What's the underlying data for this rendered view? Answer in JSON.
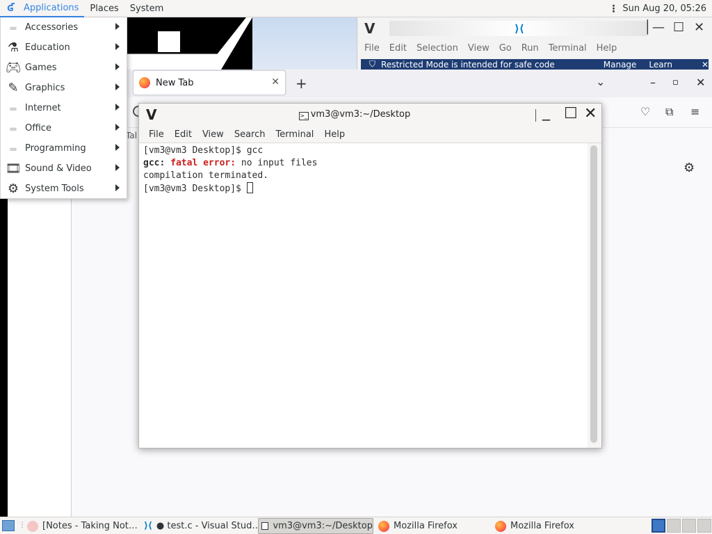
{
  "top_panel": {
    "menus": [
      "Applications",
      "Places",
      "System"
    ],
    "clock": "Sun Aug 20, 05:26"
  },
  "apps_menu": {
    "items": [
      {
        "label": "Accessories",
        "icon": "accessories-icon"
      },
      {
        "label": "Education",
        "icon": "education-flask-icon"
      },
      {
        "label": "Games",
        "icon": "games-gamepad-icon"
      },
      {
        "label": "Graphics",
        "icon": "graphics-palette-icon"
      },
      {
        "label": "Internet",
        "icon": "internet-icon"
      },
      {
        "label": "Office",
        "icon": "office-icon"
      },
      {
        "label": "Programming",
        "icon": "programming-icon"
      },
      {
        "label": "Sound & Video",
        "icon": "sound-video-film-icon"
      },
      {
        "label": "System Tools",
        "icon": "system-tools-gear-icon"
      }
    ]
  },
  "vscode": {
    "menus": [
      "File",
      "Edit",
      "Selection",
      "View",
      "Go",
      "Run",
      "Terminal",
      "Help"
    ],
    "banner_text": "Restricted Mode is intended for safe code browsing.",
    "banner_manage": "Manage",
    "banner_learn": "Learn More"
  },
  "firefox": {
    "tab_label": "New Tab",
    "partial_label": "Tal"
  },
  "terminal": {
    "title": "vm3@vm3:~/Desktop",
    "menus": [
      "File",
      "Edit",
      "View",
      "Search",
      "Terminal",
      "Help"
    ],
    "line1": "[vm3@vm3 Desktop]$ gcc",
    "line2_prog": "gcc:",
    "line2_err": "fatal error:",
    "line2_msg": "no input files",
    "line3": "compilation terminated.",
    "line4": "[vm3@vm3 Desktop]$"
  },
  "taskbar": {
    "tasks": [
      {
        "label": "[Notes - Taking Not…",
        "icon": "notes-app-icon"
      },
      {
        "label": "● test.c - Visual Stud…",
        "icon": "vscode-icon"
      },
      {
        "label": "vm3@vm3:~/Desktop",
        "icon": "terminal-window-icon"
      },
      {
        "label": "Mozilla Firefox",
        "icon": "firefox-icon"
      },
      {
        "label": "Mozilla Firefox",
        "icon": "firefox-icon"
      }
    ]
  },
  "colors": {
    "accent": "#3584e4",
    "error": "#cc1f1f",
    "vscode_blue": "#007acc",
    "workspace_active": "#3f78c7"
  }
}
